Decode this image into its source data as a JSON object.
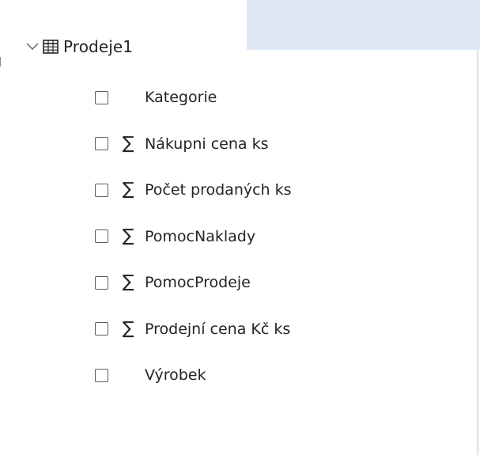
{
  "table": {
    "name": "Prodeje1",
    "expanded": true,
    "chevron_icon": "chevron-down-icon",
    "table_icon": "table-grid-icon"
  },
  "fields": [
    {
      "label": "Kategorie",
      "checked": false,
      "sigma": ""
    },
    {
      "label": "Nákupni cena ks",
      "checked": false,
      "sigma": "∑"
    },
    {
      "label": "Počet prodaných ks",
      "checked": false,
      "sigma": "∑"
    },
    {
      "label": "PomocNaklady",
      "checked": false,
      "sigma": "∑"
    },
    {
      "label": "PomocProdeje",
      "checked": false,
      "sigma": "∑"
    },
    {
      "label": "Prodejní cena Kč ks",
      "checked": false,
      "sigma": "∑"
    },
    {
      "label": "Výrobek",
      "checked": false,
      "sigma": ""
    }
  ],
  "colors": {
    "text": "#252423",
    "highlight": "#dde8f4",
    "checkbox_border": "#605e5c",
    "divider": "#e1dfdd"
  }
}
